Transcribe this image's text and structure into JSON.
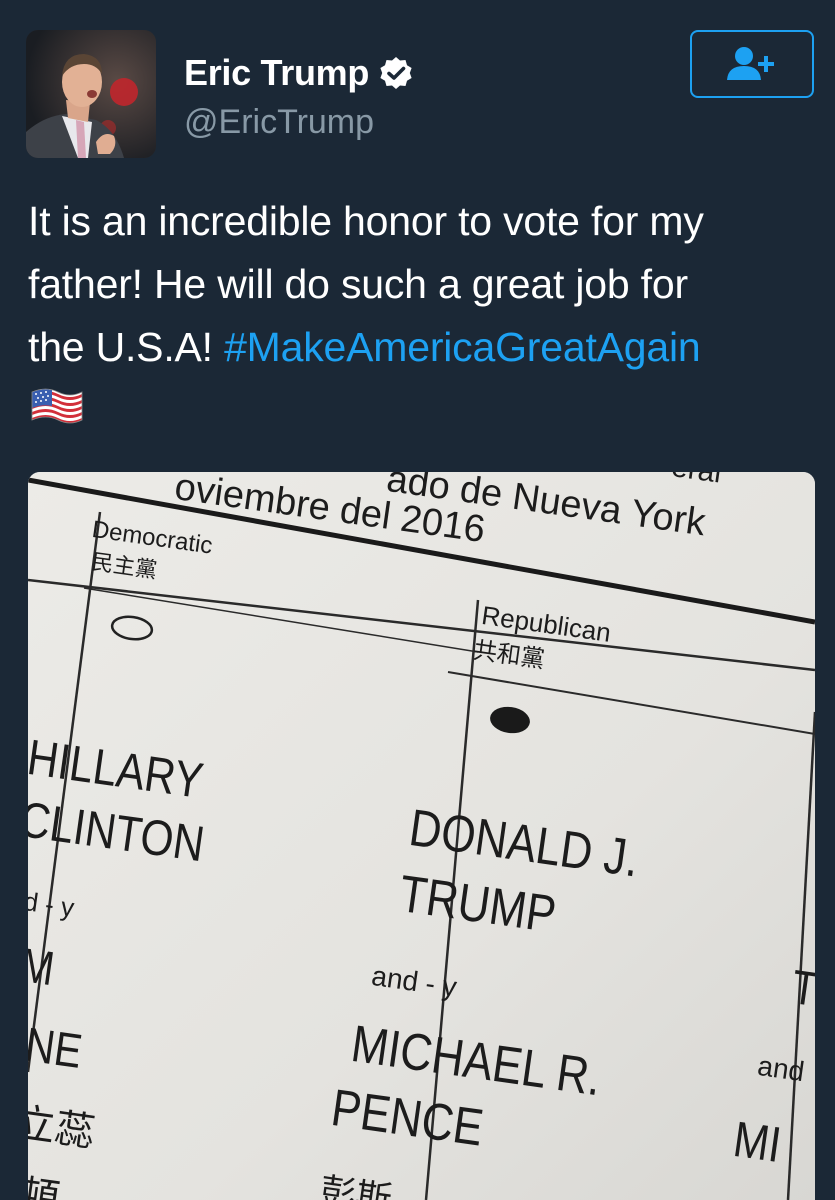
{
  "tweet": {
    "author": {
      "display_name": "Eric Trump",
      "handle": "@EricTrump",
      "verified": true,
      "avatar": "profile-photo"
    },
    "follow_button_icon": "add-user-icon",
    "text": {
      "line1": "It is an incredible honor to vote for my",
      "line2": "father! He will do such a great job for",
      "line3_prefix": "the U.S.A! ",
      "hashtag": "#MakeAmericaGreatAgain",
      "emoji": "flag-us-icon"
    },
    "colors": {
      "background": "#1b2836",
      "text": "#ffffff",
      "secondary": "#8899a6",
      "accent": "#1da1f2"
    }
  },
  "ballot": {
    "header_top": "ado de Nueva York",
    "header_top_left": "oviembre del 2016",
    "header_right": "eral",
    "dem_party": "Democratic",
    "dem_party_cn": "民主黨",
    "rep_party": "Republican",
    "rep_party_cn": "共和黨",
    "dem_name1": "HILLARY",
    "dem_name2": "CLINTON",
    "dem_andy": "d - y",
    "dem_vp1": "M",
    "dem_vp2": "INE",
    "dem_cn": "立蕊",
    "dem_cn2": "頓",
    "rep_name1": "DONALD J.",
    "rep_name2": "TRUMP",
    "rep_andy": "and - y",
    "rep_vp1": "MICHAEL R.",
    "rep_vp2": "PENCE",
    "rep_cn": "彭斯",
    "third_t": "T",
    "third_and": "and",
    "third_mi": "MI"
  }
}
